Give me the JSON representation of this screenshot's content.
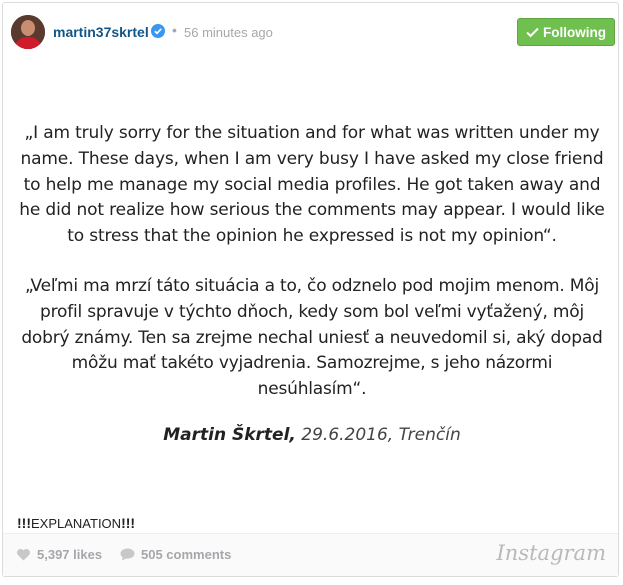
{
  "header": {
    "username": "martin37skrtel",
    "separator": "•",
    "time": "56 minutes ago",
    "follow_label": "Following"
  },
  "post": {
    "paragraph_en": "„I am truly sorry for the situation and for what was written under my name. These days, when I am very busy I have asked my close friend to help me manage my social media profiles. He got taken away and he did not realize how serious the comments may appear. I would like to stress that the opinion he expressed is not my opinion“.",
    "paragraph_sk": "„Veľmi ma mrzí táto situácia a to, čo odznelo pod mojim menom. Môj profil spravuje v týchto dňoch, kedy som bol veľmi vyťažený, môj dobrý známy. Ten sa zrejme nechal uniesť a neuvedomil si, aký dopad môžu mať takéto vyjadrenia. Samozrejme, s jeho názormi nesúhlasím“.",
    "signature_name": "Martin Škrtel,",
    "signature_rest": " 29.6.2016, Trenčín"
  },
  "caption": {
    "bangs_left": "!!!",
    "text": "EXPLANATION",
    "bangs_right": "!!!"
  },
  "footer": {
    "likes": "5,397 likes",
    "comments": "505 comments",
    "logo": "Instagram"
  },
  "colors": {
    "username": "#125688",
    "follow_button": "#70c050",
    "muted": "#a5a7aa",
    "verified": "#3897f0"
  },
  "icons": [
    "verified-badge-icon",
    "checkmark-icon",
    "heart-icon",
    "comment-bubble-icon"
  ]
}
